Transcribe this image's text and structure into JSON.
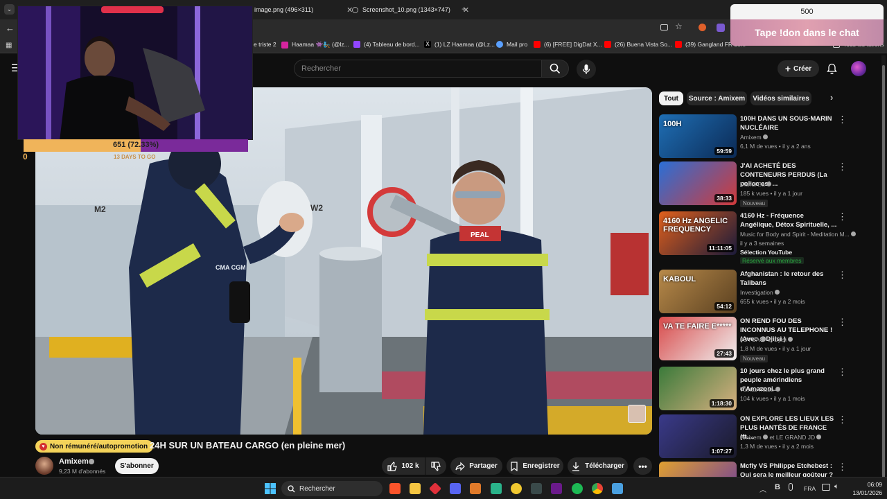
{
  "browser": {
    "tabs": [
      {
        "label": "image.png (496×311)"
      },
      {
        "label": "Screenshot_10.png (1343×747)"
      }
    ],
    "bookmarks": [
      {
        "label": "e triste 2",
        "color": "#ffcc33"
      },
      {
        "label": "Haamaa 👾🧞 (@lz...",
        "color": "#d6249f"
      },
      {
        "label": "(4) Tableau de bord...",
        "color": "#9146ff"
      },
      {
        "label": "(1) LZ Haamaa (@Lz...",
        "color": "#000000"
      },
      {
        "label": "Mail pro",
        "color": "#5aa0ff"
      },
      {
        "label": "(6) [FREE] DigDat X...",
        "color": "#ff0000"
      },
      {
        "label": "(26) Buena Vista So...",
        "color": "#ff0000"
      },
      {
        "label": "(39) Gangland FR Le...",
        "color": "#ff0000"
      }
    ],
    "all_bookmarks": "Tous les favoris"
  },
  "overlay": {
    "donation_amount": "500",
    "donation_text": "Tape !don dans le chat",
    "subgoal_text": "651 (72.33%)",
    "subgoal_progress": 0.7233,
    "subgoal_min": "0",
    "subgoal_days": "13 DAYS TO GO"
  },
  "header": {
    "search_placeholder": "Rechercher",
    "create_label": "Créer"
  },
  "video": {
    "promo_label": "Non rémunéré/autopromotion",
    "title": "24H SUR UN BATEAU CARGO (en pleine mer)",
    "channel": "Amixem",
    "subscribers": "9,23 M d'abonnés",
    "subscribe_label": "S'abonner",
    "likes": "102 k",
    "share_label": "Partager",
    "save_label": "Enregistrer",
    "download_label": "Télécharger",
    "in_video_labels": {
      "m2": "M2",
      "w2": "W2",
      "logo": "CMA CGM",
      "collar": "PEAL"
    }
  },
  "sidebar": {
    "chips": [
      "Tout",
      "Source : Amixem",
      "Vidéos similaires"
    ],
    "recommendations": [
      {
        "title": "100H DANS UN SOUS-MARIN NUCLÉAIRE",
        "channel": "Amixem",
        "meta": "6,1 M de vues • il y a 2 ans",
        "duration": "59:59",
        "badge": "",
        "thumb_text": "100H",
        "colors": [
          "#1f6fb5",
          "#0b2a55"
        ]
      },
      {
        "title": "J'AI ACHETÉ DES CONTENEURS PERDUS (La police est ...",
        "channel": "Mahdi Ba",
        "meta": "185 k vues • il y a 1 jour",
        "duration": "38:33",
        "badge": "Nouveau",
        "thumb_text": "",
        "colors": [
          "#2a6fd6",
          "#d23a3a"
        ]
      },
      {
        "title": "4160 Hz - Fréquence Angélique, Détox Spirituelle, ...",
        "channel": "Music for Body and Spirit - Meditation M...",
        "meta": "il y a 3 semaines",
        "duration": "11:11:05",
        "badge": "",
        "extra1": "Sélection YouTube",
        "extra2": "Réservé aux membres",
        "thumb_text": "4160 Hz ANGELIC FREQUENCY",
        "colors": [
          "#e0601c",
          "#1a1a3a"
        ]
      },
      {
        "title": "Afghanistan : le retour des Talibans",
        "channel": "Investigation",
        "meta": "655 k vues • il y a 2 mois",
        "duration": "54:12",
        "badge": "",
        "thumb_text": "KABOUL",
        "colors": [
          "#b88a4a",
          "#5a4020"
        ]
      },
      {
        "title": "ON REND FOU DES INCONNUS AU TELEPHONE ! (Avec @Djilsi )",
        "channel": "JOYCA",
        "channel2": "et Djilsi",
        "meta": "1,8 M de vues • il y a 1 jour",
        "duration": "27:43",
        "badge": "Nouveau",
        "thumb_text": "VA TE FAIRE E*****",
        "colors": [
          "#d84a4a",
          "#f0f0f0"
        ]
      },
      {
        "title": "10 jours chez le plus grand peuple amérindiens d'Amazoni...",
        "channel": "Tomas Masa",
        "meta": "104 k vues • il y a 1 mois",
        "duration": "1:18:30",
        "badge": "",
        "thumb_text": "",
        "colors": [
          "#3a7a3a",
          "#d8b080"
        ]
      },
      {
        "title": "ON EXPLORE LES LIEUX LES PLUS HANTÉS DE FRANCE (ft....",
        "channel": "Amixem",
        "channel2": "et LE GRAND JD",
        "meta": "1,3 M de vues • il y a 2 mois",
        "duration": "1:07:27",
        "badge": "",
        "thumb_text": "",
        "colors": [
          "#3a3a8a",
          "#1a1a2a"
        ]
      },
      {
        "title": "Mcfly VS Philippe Etchebest : Qui sera le meilleur goûteur ?",
        "channel": "",
        "meta": "",
        "duration": "",
        "badge": "",
        "thumb_text": "",
        "colors": [
          "#e0a030",
          "#6a3aa0"
        ]
      }
    ]
  },
  "taskbar": {
    "search_label": "Rechercher",
    "lang": "FRA",
    "time": "06:09",
    "date": "13/01/2026"
  }
}
